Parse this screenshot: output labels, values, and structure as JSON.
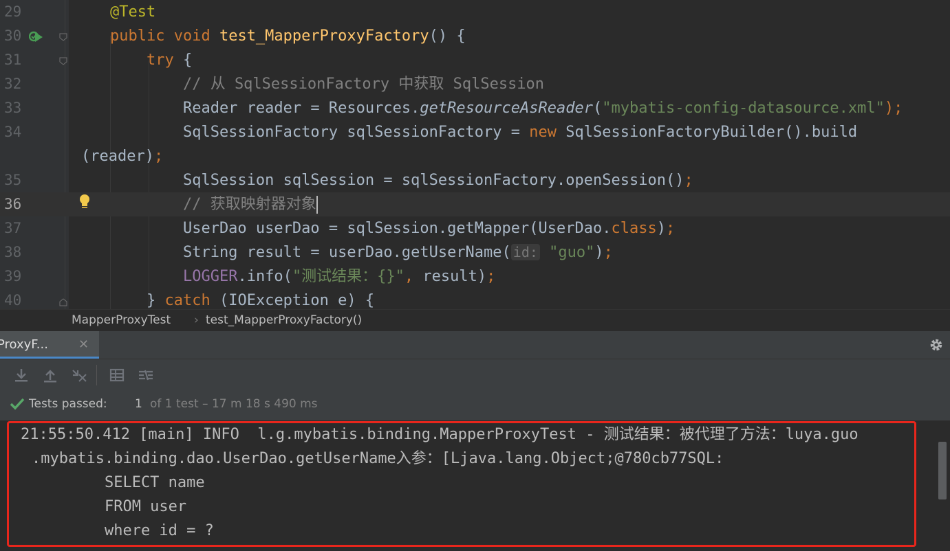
{
  "editor": {
    "lines": [
      {
        "num": "29",
        "tokens": [
          {
            "t": "@Test",
            "c": "ann"
          }
        ]
      },
      {
        "num": "30",
        "tokens": [
          {
            "t": "public ",
            "c": "kw"
          },
          {
            "t": "void ",
            "c": "kw"
          },
          {
            "t": "test_MapperProxyFactory",
            "c": "fn"
          },
          {
            "t": "() {",
            "c": ""
          }
        ]
      },
      {
        "num": "31",
        "tokens": [
          {
            "t": "    try ",
            "c": "kw"
          },
          {
            "t": "{",
            "c": ""
          }
        ]
      },
      {
        "num": "32",
        "tokens": [
          {
            "t": "        // 从 SqlSessionFactory 中获取 SqlSession",
            "c": "cm"
          }
        ]
      },
      {
        "num": "33",
        "tokens": [
          {
            "t": "        Reader reader = Resources.",
            "c": ""
          },
          {
            "t": "getResourceAsReader",
            "c": "it"
          },
          {
            "t": "(",
            "c": ""
          },
          {
            "t": "\"mybatis-config-datasource.xml\"",
            "c": "str"
          },
          {
            "t": ");",
            "c": "kw"
          }
        ]
      },
      {
        "num": "34",
        "tokens": [
          {
            "t": "        SqlSessionFactory sqlSessionFactory = ",
            "c": ""
          },
          {
            "t": "new ",
            "c": "kw"
          },
          {
            "t": "SqlSessionFactoryBuilder().build",
            "c": ""
          }
        ]
      },
      {
        "num": "",
        "tokens": [
          {
            "t": "(reader)",
            "c": ""
          },
          {
            "t": ";",
            "c": "kw"
          }
        ]
      },
      {
        "num": "35",
        "tokens": [
          {
            "t": "        SqlSession sqlSession = sqlSessionFactory.openSession()",
            "c": ""
          },
          {
            "t": ";",
            "c": "kw"
          }
        ]
      },
      {
        "num": "36",
        "tokens": [
          {
            "t": "        // 获取映射器对象",
            "c": "cm"
          }
        ]
      },
      {
        "num": "37",
        "tokens": [
          {
            "t": "        UserDao userDao = sqlSession.getMapper(UserDao.",
            "c": ""
          },
          {
            "t": "class",
            "c": "kw"
          },
          {
            "t": ")",
            "c": ""
          },
          {
            "t": ";",
            "c": "kw"
          }
        ]
      },
      {
        "num": "38",
        "tokens": [
          {
            "t": "        String result = userDao.getUserName(",
            "c": ""
          },
          {
            "t": "id:",
            "c": "hint"
          },
          {
            "t": " ",
            "c": ""
          },
          {
            "t": "\"guo\"",
            "c": "str"
          },
          {
            "t": ")",
            "c": ""
          },
          {
            "t": ";",
            "c": "kw"
          }
        ]
      },
      {
        "num": "39",
        "tokens": [
          {
            "t": "        ",
            "c": ""
          },
          {
            "t": "LOGGER",
            "c": "const"
          },
          {
            "t": ".info(",
            "c": ""
          },
          {
            "t": "\"测试结果：{}\"",
            "c": "str"
          },
          {
            "t": ", ",
            "c": "kw"
          },
          {
            "t": "result)",
            "c": ""
          },
          {
            "t": ";",
            "c": "kw"
          }
        ]
      },
      {
        "num": "40",
        "tokens": [
          {
            "t": "    } ",
            "c": ""
          },
          {
            "t": "catch ",
            "c": "kw"
          },
          {
            "t": "(IOException e) {",
            "c": ""
          }
        ]
      }
    ]
  },
  "breadcrumb": {
    "class_name": "MapperProxyTest",
    "separator": "›",
    "method_name": "test_MapperProxyFactory()"
  },
  "run_panel": {
    "tab_label": "ProxyF...",
    "status": {
      "label": "Tests passed:",
      "count": "1",
      "detail": "of 1 test – 17 m 18 s 490 ms"
    },
    "console_lines": [
      "21:55:50.412 [main] INFO  l.g.mybatis.binding.MapperProxyTest - 测试结果：被代理了方法：luya.guo",
      ".mybatis.binding.dao.UserDao.getUserName入参：[Ljava.lang.Object;@780cb77SQL:",
      "        SELECT name",
      "        FROM user",
      "        where id = ?"
    ]
  },
  "colors": {
    "highlight_box": "#e8261c",
    "passed_check": "#59a869",
    "tab_underline": "#4a88c7"
  }
}
